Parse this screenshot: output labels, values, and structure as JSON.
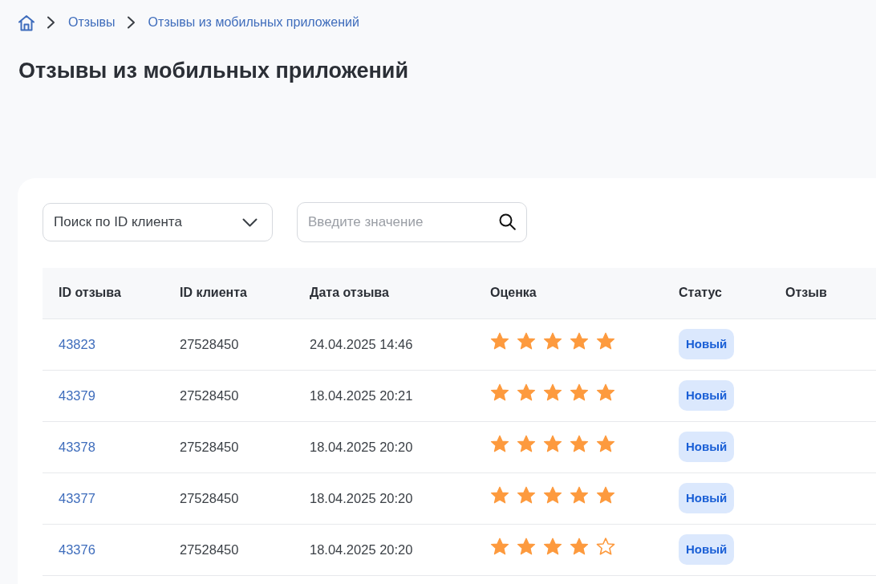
{
  "breadcrumb": {
    "items": [
      "Отзывы",
      "Отзывы из мобильных приложений"
    ]
  },
  "title": "Отзывы из мобильных приложений",
  "filters": {
    "search_type": {
      "value": "Поиск по ID клиента"
    },
    "search": {
      "placeholder": "Введите значение"
    }
  },
  "table": {
    "columns": [
      "ID отзыва",
      "ID клиента",
      "Дата отзыва",
      "Оценка",
      "Статус",
      "Отзыв"
    ],
    "rows": [
      {
        "review_id": "43823",
        "client_id": "27528450",
        "date": "24.04.2025 14:46",
        "stars": 5,
        "status": "Новый"
      },
      {
        "review_id": "43379",
        "client_id": "27528450",
        "date": "18.04.2025 20:21",
        "stars": 5,
        "status": "Новый"
      },
      {
        "review_id": "43378",
        "client_id": "27528450",
        "date": "18.04.2025 20:20",
        "stars": 5,
        "status": "Новый"
      },
      {
        "review_id": "43377",
        "client_id": "27528450",
        "date": "18.04.2025 20:20",
        "stars": 5,
        "status": "Новый"
      },
      {
        "review_id": "43376",
        "client_id": "27528450",
        "date": "18.04.2025 20:20",
        "stars": 4,
        "status": "Новый"
      }
    ]
  }
}
